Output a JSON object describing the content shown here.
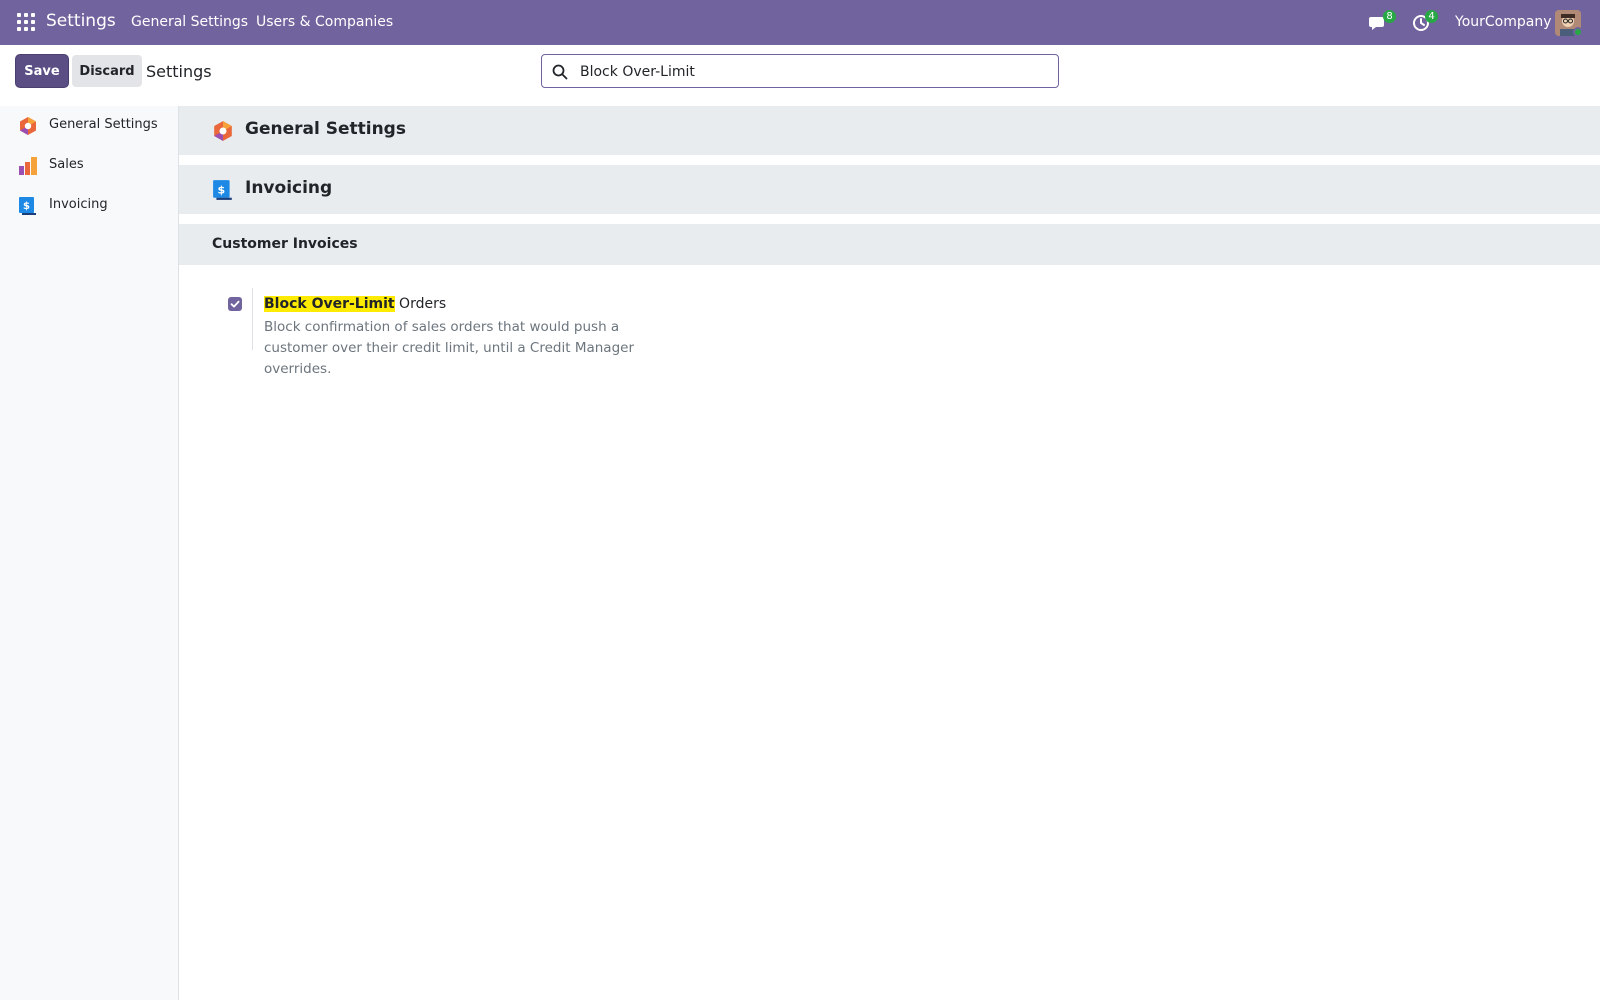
{
  "navbar": {
    "brand": "Settings",
    "menus": [
      "General Settings",
      "Users & Companies"
    ],
    "messages_count": "8",
    "activities_count": "4",
    "company": "YourCompany"
  },
  "control_panel": {
    "save_label": "Save",
    "discard_label": "Discard",
    "title": "Settings",
    "search_value": "Block Over-Limit"
  },
  "sidebar": {
    "items": [
      {
        "label": "General Settings",
        "icon": "general-settings-icon"
      },
      {
        "label": "Sales",
        "icon": "sales-icon"
      },
      {
        "label": "Invoicing",
        "icon": "invoicing-icon"
      }
    ]
  },
  "main": {
    "apps": [
      {
        "title": "General Settings",
        "icon": "general-settings-icon"
      },
      {
        "title": "Invoicing",
        "icon": "invoicing-icon"
      }
    ],
    "section_title": "Customer Invoices",
    "setting": {
      "label_highlight": "Block Over-Limit",
      "label_rest": " Orders",
      "checked": true,
      "help": "Block confirmation of sales orders that would push a customer over their credit limit, until a Credit Manager overrides."
    }
  },
  "colors": {
    "navbar": "#71639e",
    "primary_button": "#5b4e84",
    "highlight": "#ffeb00",
    "badge": "#28a745"
  }
}
